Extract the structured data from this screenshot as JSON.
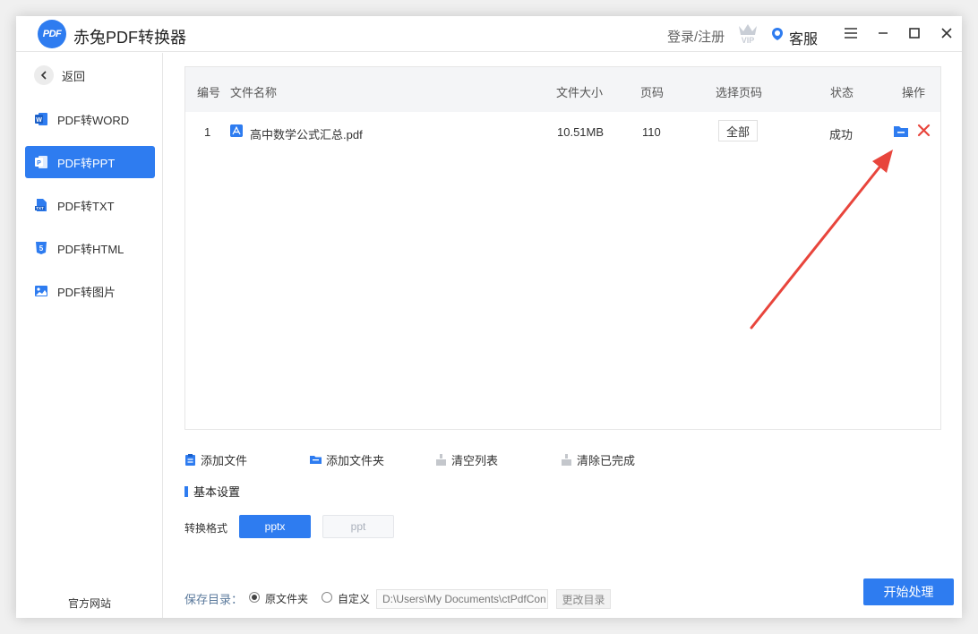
{
  "app": {
    "logo_text": "PDF",
    "title": "赤兔PDF转换器"
  },
  "header": {
    "login_label": "登录/注册",
    "vip_badge": "VIP",
    "service_label": "客服"
  },
  "sidebar": {
    "back_label": "返回",
    "items": [
      {
        "label": "PDF转WORD",
        "icon": "word-icon",
        "active": false
      },
      {
        "label": "PDF转PPT",
        "icon": "ppt-icon",
        "active": true
      },
      {
        "label": "PDF转TXT",
        "icon": "txt-icon",
        "active": false
      },
      {
        "label": "PDF转HTML",
        "icon": "html-icon",
        "active": false
      },
      {
        "label": "PDF转图片",
        "icon": "image-icon",
        "active": false
      }
    ],
    "official_site": "官方网站"
  },
  "table": {
    "headers": {
      "index": "编号",
      "name": "文件名称",
      "size": "文件大小",
      "pages": "页码",
      "select_pages": "选择页码",
      "status": "状态",
      "actions": "操作"
    },
    "rows": [
      {
        "index": "1",
        "name": "高中数学公式汇总.pdf",
        "size": "10.51MB",
        "pages": "110",
        "select_pages": "全部",
        "status": "成功"
      }
    ]
  },
  "toolbar": {
    "add_file": "添加文件",
    "add_folder": "添加文件夹",
    "clear_list": "清空列表",
    "clear_done": "清除已完成"
  },
  "settings": {
    "title": "基本设置",
    "format_label": "转换格式",
    "formats": [
      "pptx",
      "ppt"
    ],
    "selected_format": "pptx"
  },
  "footer": {
    "save_dir_label": "保存目录：",
    "option_original": "原文件夹",
    "option_custom": "自定义",
    "selected_option": "原文件夹",
    "path": "D:\\Users\\My Documents\\ctPdfCon",
    "change_dir": "更改目录",
    "start_button": "开始处理"
  },
  "colors": {
    "accent": "#2e7cf0",
    "delete": "#e8453c",
    "annotation_arrow": "#e8453c"
  }
}
